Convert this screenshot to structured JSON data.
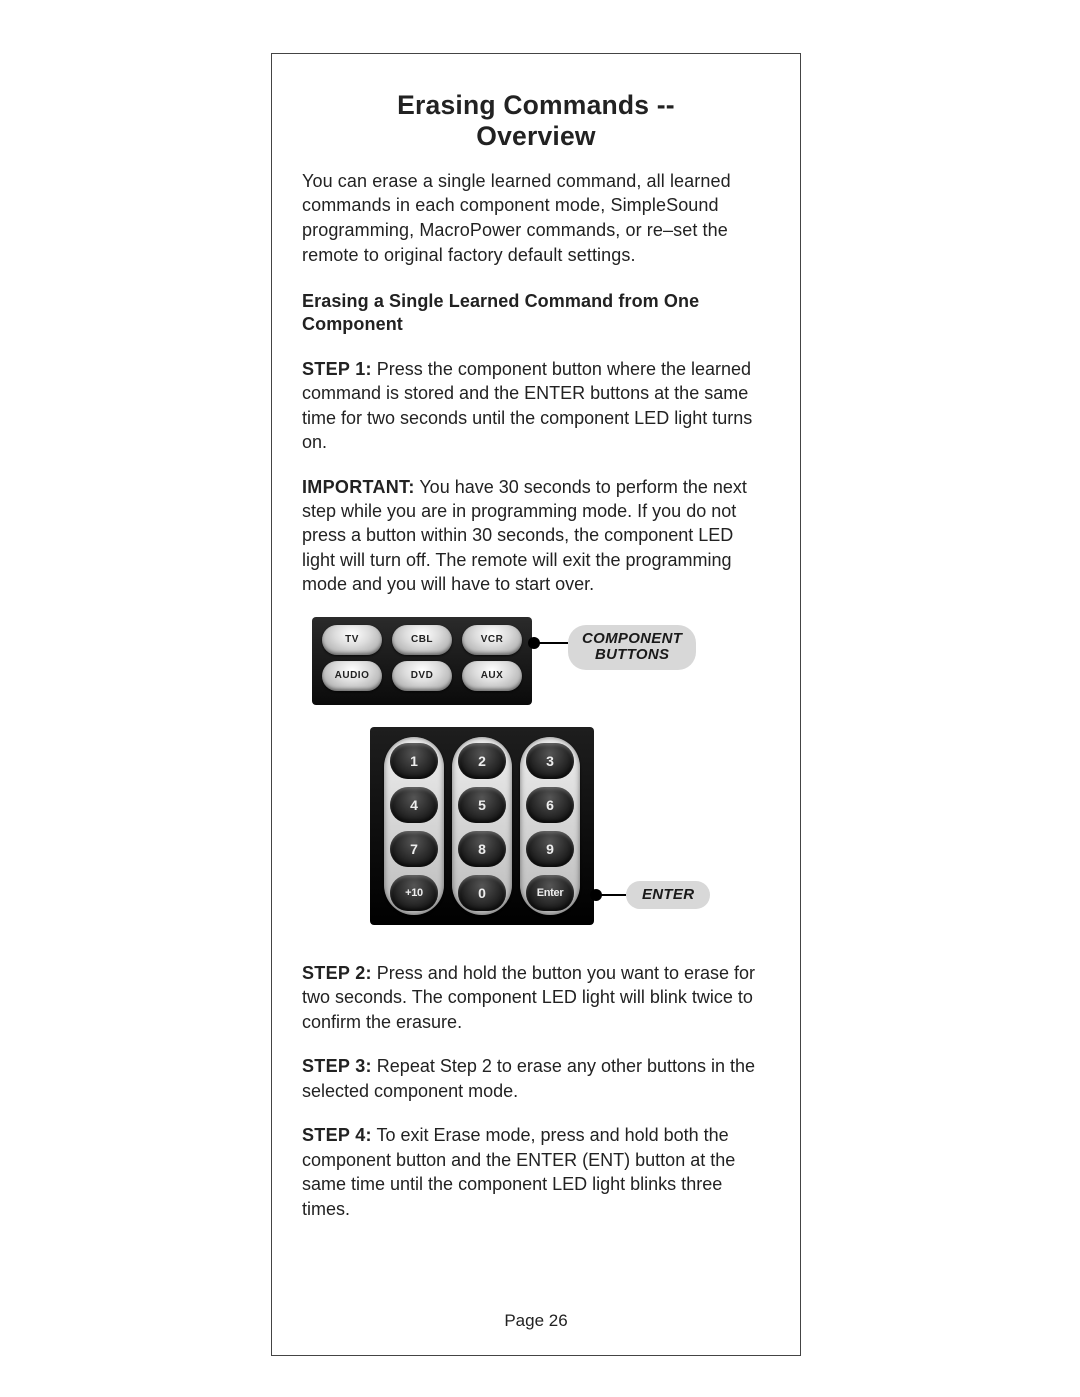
{
  "title_line1": "Erasing Commands --",
  "title_line2": "Overview",
  "intro": "You can erase a single learned command, all learned commands in each component mode, SimpleSound programming, MacroPower commands, or re–set the remote to original factory default settings.",
  "subheading": "Erasing a Single Learned Command from One Component",
  "step1_lead": "STEP 1:",
  "step1_body": " Press the component button where the learned command is stored and the ENTER buttons at the same time for two seconds until the component LED light turns on.",
  "important_lead": "IMPORTANT:",
  "important_body": " You have 30 seconds to perform the next step while you are in programming mode. If you do not press a button within 30 seconds, the component LED light will turn off. The remote will exit the programming mode and you will have to start over.",
  "component_buttons": {
    "row1": [
      "TV",
      "CBL",
      "VCR"
    ],
    "row2": [
      "AUDIO",
      "DVD",
      "AUX"
    ]
  },
  "callout_component_line1": "COMPONENT",
  "callout_component_line2": "BUTTONS",
  "keypad": {
    "col1": [
      "1",
      "4",
      "7",
      "+10"
    ],
    "col2": [
      "2",
      "5",
      "8",
      "0"
    ],
    "col3": [
      "3",
      "6",
      "9",
      "Enter"
    ]
  },
  "callout_enter": "ENTER",
  "step2_lead": "STEP 2:",
  "step2_body": " Press and hold the button you want to erase for two seconds. The component LED light will blink twice to confirm the erasure.",
  "step3_lead": "STEP 3:",
  "step3_body": " Repeat Step 2 to erase any other buttons in the selected component mode.",
  "step4_lead": "STEP 4:",
  "step4_body": " To exit Erase mode, press and hold both the component button and the ENTER (ENT) button at the same time until the component LED light blinks three times.",
  "page_number": "Page 26"
}
